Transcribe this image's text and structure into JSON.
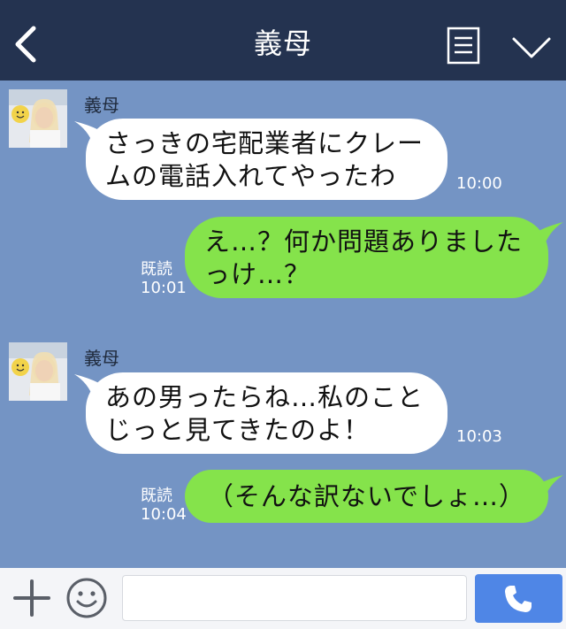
{
  "header": {
    "title": "義母",
    "back_icon": "chevron-left-icon",
    "menu_icon": "notes-icon",
    "dropdown_icon": "chevron-down-icon"
  },
  "messages": [
    {
      "direction": "in",
      "sender": "義母",
      "lines": [
        "さっきの宅配業者にクレー",
        "ムの電話入れてやったわ"
      ],
      "time": "10:00"
    },
    {
      "direction": "out",
      "lines": [
        "え…？何か問題ありました",
        "っけ…？"
      ],
      "read": "既読",
      "time": "10:01"
    },
    {
      "direction": "in",
      "sender": "義母",
      "lines": [
        "あの男ったらね…私のこと",
        "じっと見てきたのよ！"
      ],
      "time": "10:03"
    },
    {
      "direction": "out",
      "lines": [
        "（そんな訳ないでしょ…）"
      ],
      "read": "既読",
      "time": "10:04"
    }
  ],
  "footer": {
    "add_icon": "plus-icon",
    "emoji_icon": "smiley-icon",
    "input_value": "",
    "call_icon": "phone-icon"
  },
  "colors": {
    "header_bg": "#243350",
    "chat_bg": "#7494c4",
    "incoming_bubble": "#ffffff",
    "outgoing_bubble": "#85e34b",
    "call_button": "#4f86e6"
  }
}
